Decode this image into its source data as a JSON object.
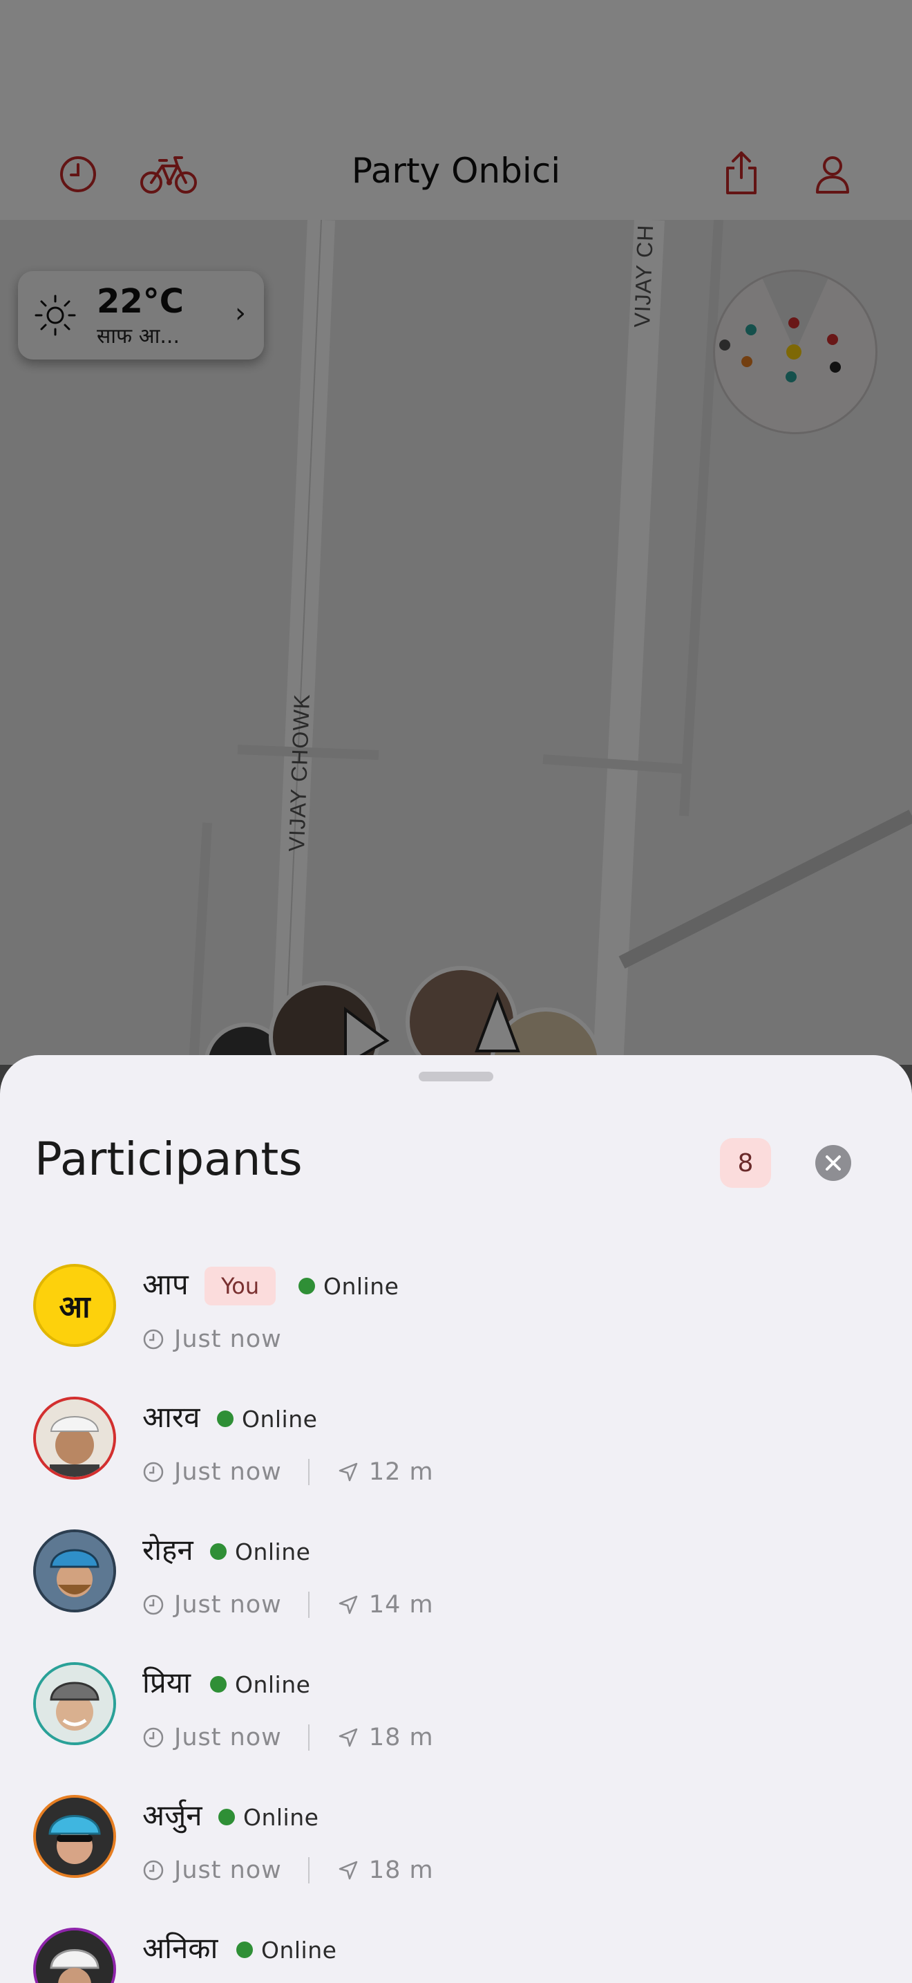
{
  "header": {
    "title": "Party Onbici",
    "history_icon": "clock-icon",
    "bike_icon": "bicycle-icon",
    "share_icon": "share-icon",
    "profile_icon": "person-icon",
    "accent": "#c62828"
  },
  "map": {
    "street_labels": [
      "VIJAY CHOWK",
      "VIJAY CH"
    ]
  },
  "weather": {
    "icon": "sun-icon",
    "temperature": "22°C",
    "condition": "साफ आ..."
  },
  "sheet": {
    "title": "Participants",
    "count": "8",
    "close_icon": "close-icon",
    "participants": [
      {
        "name": "आप",
        "initial": "आ",
        "you_label": "You",
        "status": "Online",
        "last_seen": "Just now",
        "distance": ""
      },
      {
        "name": "आरव",
        "status": "Online",
        "last_seen": "Just now",
        "distance": "12 m",
        "ring": "#d32f2f"
      },
      {
        "name": "रोहन",
        "status": "Online",
        "last_seen": "Just now",
        "distance": "14 m",
        "ring": "#2c3e50"
      },
      {
        "name": "प्रिया",
        "status": "Online",
        "last_seen": "Just now",
        "distance": "18 m",
        "ring": "#2aa198"
      },
      {
        "name": "अर्जुन",
        "status": "Online",
        "last_seen": "Just now",
        "distance": "18 m",
        "ring": "#e67e22"
      },
      {
        "name": "अनिका",
        "status": "Online",
        "last_seen": "",
        "distance": "",
        "ring": "#8e24aa"
      }
    ]
  },
  "colors": {
    "online": "#2f8f36",
    "you_badge_bg": "#fbdcdc",
    "initial_avatar": "#fdd10c"
  }
}
